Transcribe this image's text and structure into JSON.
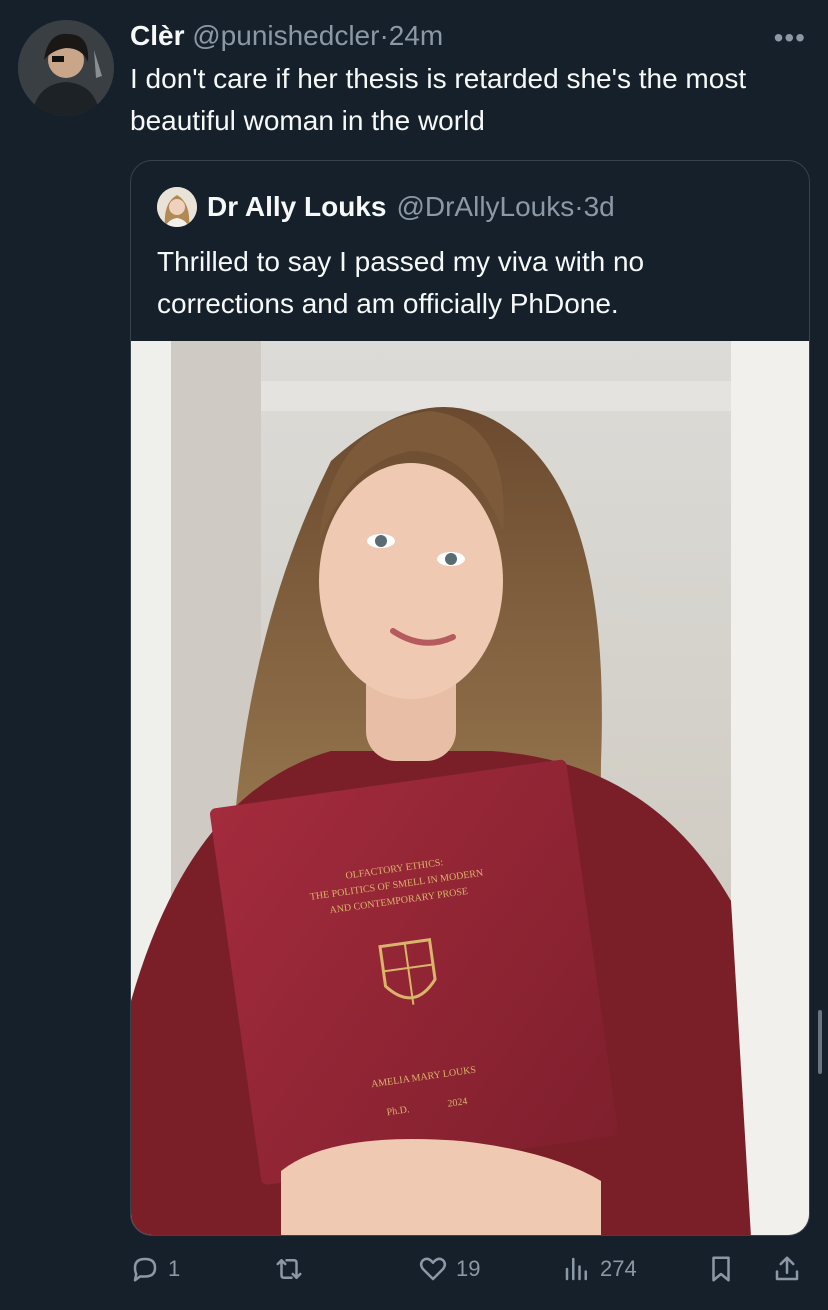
{
  "tweet": {
    "author_name": "Clèr",
    "author_handle": "@punishedcler",
    "separator": "·",
    "time": "24m",
    "text": "I don't care if her thesis is retarded she's the most beautiful woman in the world",
    "more_icon": "more-horizontal-icon"
  },
  "quoted_tweet": {
    "author_name": "Dr Ally Louks",
    "author_handle": "@DrAllyLouks",
    "separator": "·",
    "time": "3d",
    "text": "Thrilled to say I passed my viva with no corrections and am officially PhDone.",
    "thesis_cover": {
      "title_line1": "OLFACTORY ETHICS:",
      "title_line2": "THE POLITICS OF SMELL IN MODERN",
      "title_line3": "AND CONTEMPORARY PROSE",
      "author": "AMELIA MARY LOUKS",
      "degree": "Ph.D.",
      "year": "2024"
    }
  },
  "actions": {
    "reply_count": "1",
    "retweet_count": "",
    "like_count": "19",
    "views_count": "274"
  },
  "colors": {
    "background": "#15202b",
    "text_primary": "#f7f9f9",
    "text_secondary": "#8b98a5",
    "border": "#38444d",
    "thesis_red": "#8f2232",
    "gold": "#d9b46a"
  }
}
